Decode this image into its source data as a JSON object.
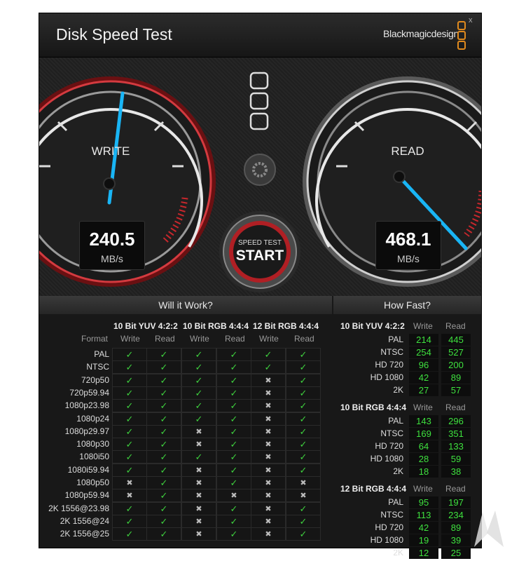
{
  "window": {
    "title": "Disk Speed Test",
    "brand": "Blackmagicdesign",
    "close": "x"
  },
  "write_gauge": {
    "label": "WRITE",
    "value": "240.5",
    "unit": "MB/s"
  },
  "read_gauge": {
    "label": "READ",
    "value": "468.1",
    "unit": "MB/s"
  },
  "start_button": {
    "top": "SPEED TEST",
    "main": "START"
  },
  "will_it_work": {
    "header": "Will it Work?",
    "format_label": "Format",
    "groups": [
      "10 Bit YUV 4:2:2",
      "10 Bit RGB 4:4:4",
      "12 Bit RGB 4:4:4"
    ],
    "sub": [
      "Write",
      "Read",
      "Write",
      "Read",
      "Write",
      "Read"
    ],
    "rows": [
      {
        "f": "PAL",
        "c": [
          1,
          1,
          1,
          1,
          1,
          1
        ]
      },
      {
        "f": "NTSC",
        "c": [
          1,
          1,
          1,
          1,
          1,
          1
        ]
      },
      {
        "f": "720p50",
        "c": [
          1,
          1,
          1,
          1,
          0,
          1
        ]
      },
      {
        "f": "720p59.94",
        "c": [
          1,
          1,
          1,
          1,
          0,
          1
        ]
      },
      {
        "f": "1080p23.98",
        "c": [
          1,
          1,
          1,
          1,
          0,
          1
        ]
      },
      {
        "f": "1080p24",
        "c": [
          1,
          1,
          1,
          1,
          0,
          1
        ]
      },
      {
        "f": "1080p29.97",
        "c": [
          1,
          1,
          0,
          1,
          0,
          1
        ]
      },
      {
        "f": "1080p30",
        "c": [
          1,
          1,
          0,
          1,
          0,
          1
        ]
      },
      {
        "f": "1080i50",
        "c": [
          1,
          1,
          1,
          1,
          0,
          1
        ]
      },
      {
        "f": "1080i59.94",
        "c": [
          1,
          1,
          0,
          1,
          0,
          1
        ]
      },
      {
        "f": "1080p50",
        "c": [
          0,
          1,
          0,
          1,
          0,
          0
        ]
      },
      {
        "f": "1080p59.94",
        "c": [
          0,
          1,
          0,
          0,
          0,
          0
        ]
      },
      {
        "f": "2K 1556@23.98",
        "c": [
          1,
          1,
          0,
          1,
          0,
          1
        ]
      },
      {
        "f": "2K 1556@24",
        "c": [
          1,
          1,
          0,
          1,
          0,
          1
        ]
      },
      {
        "f": "2K 1556@25",
        "c": [
          1,
          1,
          0,
          1,
          0,
          1
        ]
      }
    ]
  },
  "how_fast": {
    "header": "How Fast?",
    "sub": [
      "Write",
      "Read"
    ],
    "sections": [
      {
        "name": "10 Bit YUV 4:2:2",
        "rows": [
          {
            "f": "PAL",
            "w": "214",
            "r": "445"
          },
          {
            "f": "NTSC",
            "w": "254",
            "r": "527"
          },
          {
            "f": "HD 720",
            "w": "96",
            "r": "200"
          },
          {
            "f": "HD 1080",
            "w": "42",
            "r": "89"
          },
          {
            "f": "2K",
            "w": "27",
            "r": "57"
          }
        ]
      },
      {
        "name": "10 Bit RGB 4:4:4",
        "rows": [
          {
            "f": "PAL",
            "w": "143",
            "r": "296"
          },
          {
            "f": "NTSC",
            "w": "169",
            "r": "351"
          },
          {
            "f": "HD 720",
            "w": "64",
            "r": "133"
          },
          {
            "f": "HD 1080",
            "w": "28",
            "r": "59"
          },
          {
            "f": "2K",
            "w": "18",
            "r": "38"
          }
        ]
      },
      {
        "name": "12 Bit RGB 4:4:4",
        "rows": [
          {
            "f": "PAL",
            "w": "95",
            "r": "197"
          },
          {
            "f": "NTSC",
            "w": "113",
            "r": "234"
          },
          {
            "f": "HD 720",
            "w": "42",
            "r": "89"
          },
          {
            "f": "HD 1080",
            "w": "19",
            "r": "39"
          },
          {
            "f": "2K",
            "w": "12",
            "r": "25"
          }
        ]
      }
    ]
  },
  "colors": {
    "accent_red": "#c8272c",
    "needle": "#19b5f5",
    "ok_green": "#3ecf3e",
    "logo_orange": "#e08a1e"
  }
}
